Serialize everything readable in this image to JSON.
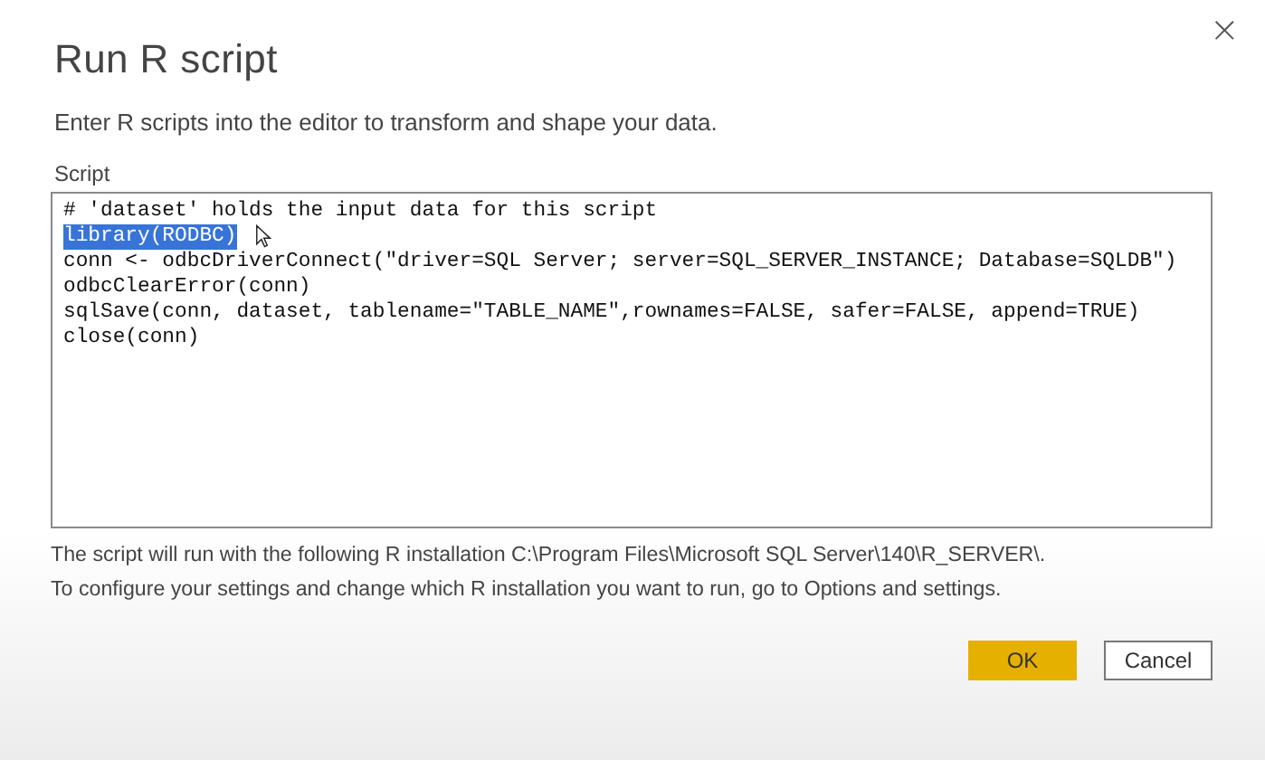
{
  "dialog": {
    "title": "Run R script",
    "close": "×",
    "description": "Enter R scripts into the editor to transform and shape your data.",
    "editor": {
      "label": "Script",
      "lines": [
        {
          "text": "# 'dataset' holds the input data for this script",
          "selected": false
        },
        {
          "text": "library(RODBC)",
          "selected": true
        },
        {
          "text": "conn <- odbcDriverConnect(\"driver=SQL Server; server=SQL_SERVER_INSTANCE; Database=SQLDB\")",
          "selected": false
        },
        {
          "text": "odbcClearError(conn)",
          "selected": false
        },
        {
          "text": "sqlSave(conn, dataset, tablename=\"TABLE_NAME\",rownames=FALSE, safer=FALSE, append=TRUE)",
          "selected": false
        },
        {
          "text": "close(conn)",
          "selected": false
        }
      ]
    },
    "notes": [
      "The script will run with the following R installation C:\\Program Files\\Microsoft SQL Server\\140\\R_SERVER\\.",
      "To configure your settings and change which R installation you want to run, go to Options and settings."
    ],
    "buttons": [
      {
        "label": "OK",
        "kind": "primary"
      },
      {
        "label": "Cancel",
        "kind": "secondary"
      }
    ]
  }
}
